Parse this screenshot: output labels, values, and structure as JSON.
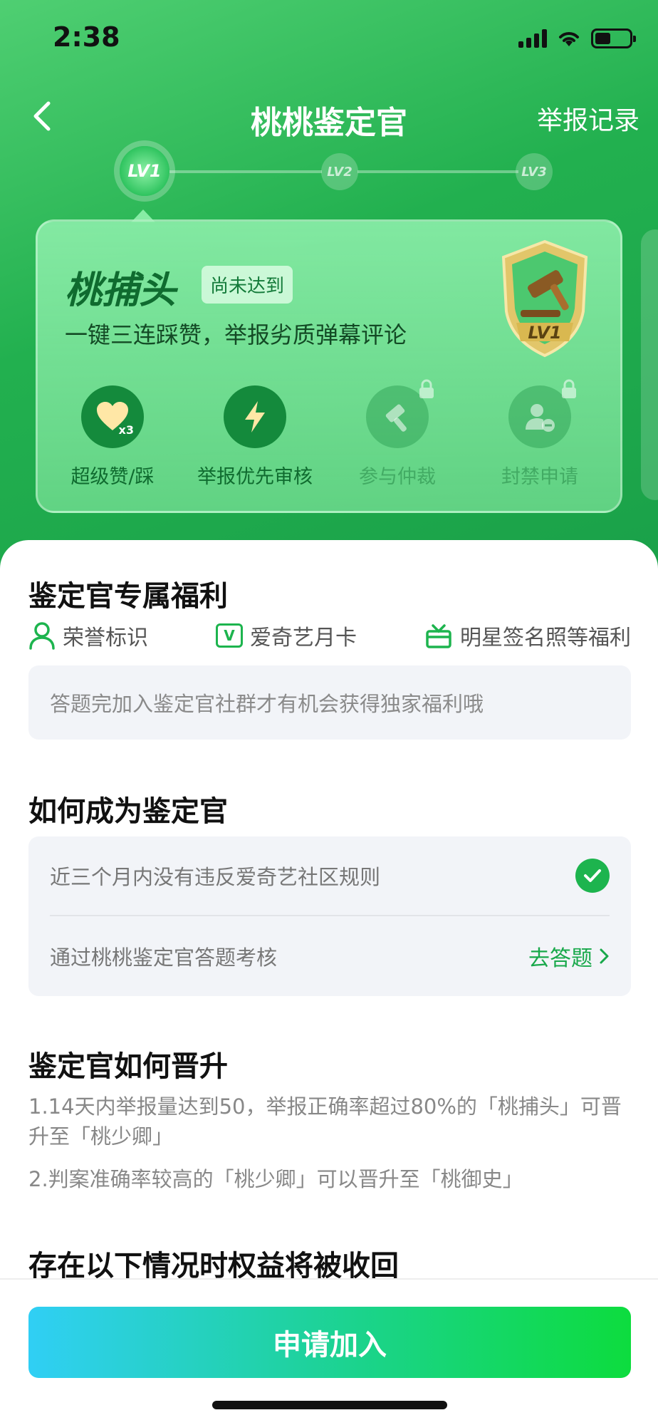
{
  "status_bar": {
    "time": "2:38"
  },
  "header": {
    "title": "桃桃鉴定官",
    "report_link": "举报记录"
  },
  "levels": [
    {
      "label": "LV1",
      "active": true
    },
    {
      "label": "LV2",
      "active": false
    },
    {
      "label": "LV3",
      "active": false
    }
  ],
  "level_card": {
    "rank_name": "桃捕头",
    "status_tag": "尚未达到",
    "description": "一键三连踩赞，举报劣质弹幕评论",
    "badge_label": "LV1",
    "perks": [
      {
        "label": "超级赞/踩",
        "icon_text": "x3",
        "unlocked": true
      },
      {
        "label": "举报优先审核",
        "unlocked": true
      },
      {
        "label": "参与仲裁",
        "unlocked": false
      },
      {
        "label": "封禁申请",
        "unlocked": false
      }
    ]
  },
  "benefits_section": {
    "title": "鉴定官专属福利",
    "items": [
      {
        "label": "荣誉标识",
        "icon": "person-icon"
      },
      {
        "label": "爱奇艺月卡",
        "icon": "v-card-icon",
        "icon_text": "V"
      },
      {
        "label": "明星签名照等福利",
        "icon": "gift-icon"
      }
    ],
    "tip": "答题完加入鉴定官社群才有机会获得独家福利哦"
  },
  "requirements_section": {
    "title": "如何成为鉴定官",
    "items": [
      {
        "label": "近三个月内没有违反爱奇艺社区规则",
        "done": true
      },
      {
        "label": "通过桃桃鉴定官答题考核",
        "action": "去答题"
      }
    ]
  },
  "promotion_section": {
    "title": "鉴定官如何晋升",
    "rules": [
      "1.14天内举报量达到50，举报正确率超过80%的「桃捕头」可晋升至「桃少卿」",
      "2.判案准确率较高的「桃少卿」可以晋升至「桃御史」"
    ]
  },
  "revoke_section": {
    "title": "存在以下情况时权益将被收回"
  },
  "apply_button": {
    "label": "申请加入"
  },
  "colors": {
    "brand_green": "#1db44e",
    "button_gradient_start": "#30cff5",
    "button_gradient_end": "#0ddc3e"
  }
}
